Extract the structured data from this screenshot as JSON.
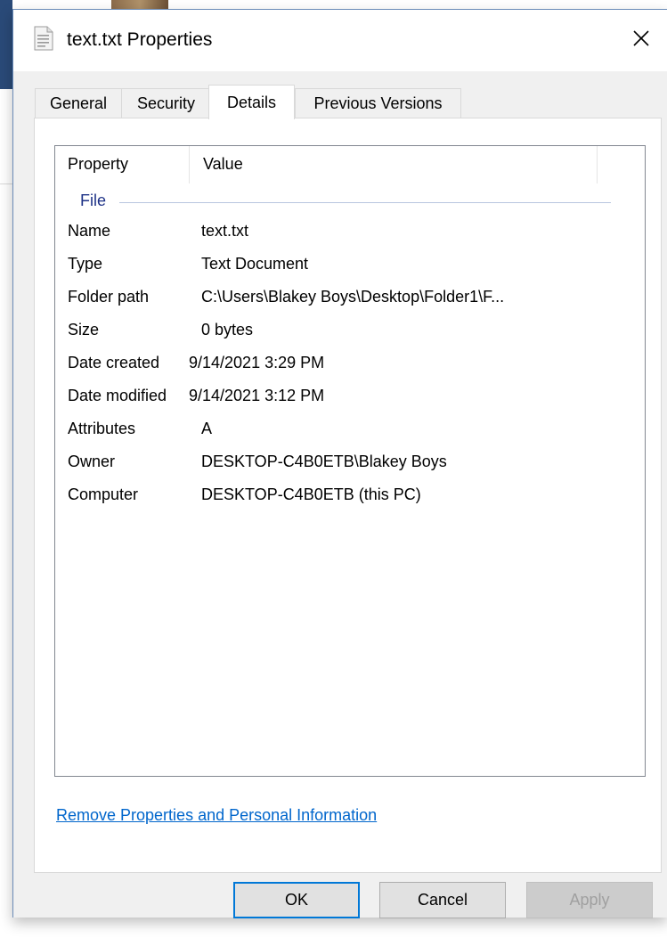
{
  "window": {
    "title": "text.txt Properties",
    "icon": "text-file-icon",
    "close_icon": "close-icon"
  },
  "tabs": [
    {
      "label": "General",
      "active": false
    },
    {
      "label": "Security",
      "active": false
    },
    {
      "label": "Details",
      "active": true
    },
    {
      "label": "Previous Versions",
      "active": false
    }
  ],
  "details": {
    "columns": {
      "property": "Property",
      "value": "Value"
    },
    "group": "File",
    "rows": [
      {
        "property": "Name",
        "value": "text.txt"
      },
      {
        "property": "Type",
        "value": "Text Document"
      },
      {
        "property": "Folder path",
        "value": "C:\\Users\\Blakey Boys\\Desktop\\Folder1\\F..."
      },
      {
        "property": "Size",
        "value": "0 bytes"
      },
      {
        "property": "Date created",
        "value": "9/14/2021 3:29 PM"
      },
      {
        "property": "Date modified",
        "value": "9/14/2021 3:12 PM"
      },
      {
        "property": "Attributes",
        "value": "A"
      },
      {
        "property": "Owner",
        "value": "DESKTOP-C4B0ETB\\Blakey Boys"
      },
      {
        "property": "Computer",
        "value": "DESKTOP-C4B0ETB (this PC)"
      }
    ]
  },
  "links": {
    "remove_properties": "Remove Properties and Personal Information"
  },
  "buttons": {
    "ok": "OK",
    "cancel": "Cancel",
    "apply": "Apply"
  },
  "colors": {
    "link": "#0066cc",
    "group_label": "#1e3287",
    "ok_focus_border": "#0078d7",
    "disabled_text": "#a0a0a0"
  }
}
